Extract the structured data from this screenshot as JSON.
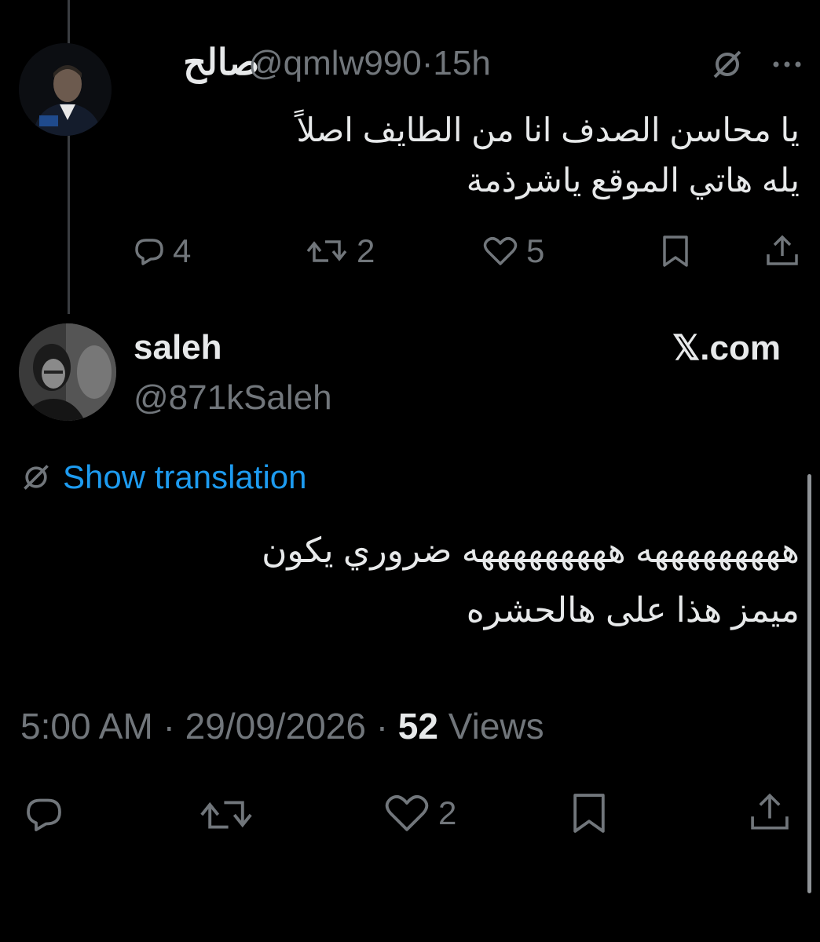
{
  "reply": {
    "display_name": "صالح",
    "handle": "@qmlw990",
    "separator": "·",
    "time": "15h",
    "text_line1": "يا محاسن الصدف انا من الطايف اصلاً",
    "text_line2": "يله هاتي الموقع ياشرذمة",
    "replies": "4",
    "reposts": "2",
    "likes": "5"
  },
  "main": {
    "display_name": "saleh",
    "handle": "@871kSaleh",
    "source": "𝕏.com",
    "translate_label": "Show translation",
    "text_line1": "هههههههههه هههههههههه ضروري يكون",
    "text_line2": "ميمز هذا على هالحشره",
    "time": "5:00 AM",
    "date": "29/09/2026",
    "sep1": "·",
    "sep2": "·",
    "views_count": "52",
    "views_label": "Views",
    "likes": "2"
  },
  "colors": {
    "background": "#000000",
    "text": "#e7e9ea",
    "muted": "#71767b",
    "link": "#1d9bf0"
  }
}
